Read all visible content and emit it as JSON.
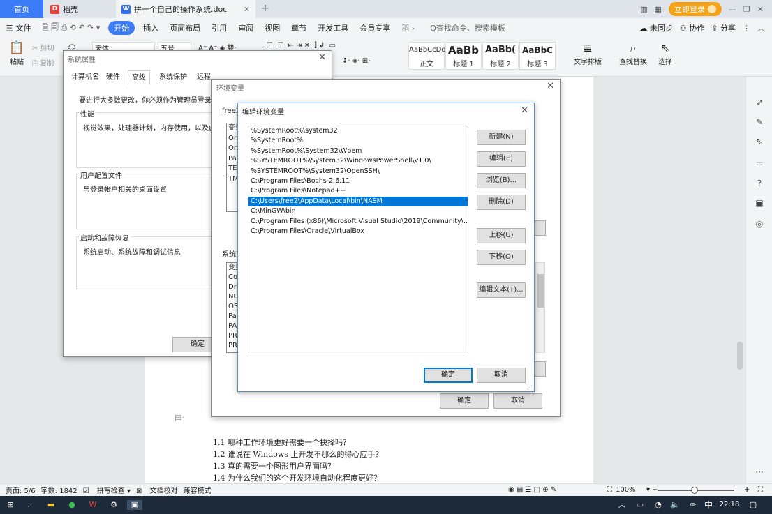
{
  "tabs": {
    "home": "首页",
    "daoke": "稻壳",
    "doc": "拼一个自己的操作系统.doc",
    "login": "立即登录"
  },
  "menu": {
    "file": "三 文件",
    "start": "开始",
    "insert": "插入",
    "layout": "页面布局",
    "ref": "引用",
    "review": "审阅",
    "view": "视图",
    "chapter": "章节",
    "dev": "开发工具",
    "member": "会员专享",
    "search": "Q查找命令、搜索模板",
    "sync": "未同步",
    "collab": "协作",
    "share": "分享"
  },
  "ribbon": {
    "paste": "粘贴",
    "cut": "剪切",
    "copy": "复制",
    "font": "宋体",
    "size": "五号",
    "styles": [
      {
        "preview": "AaBbCcDd",
        "name": "正文"
      },
      {
        "preview": "AaBb",
        "name": "标题 1"
      },
      {
        "preview": "AaBb(",
        "name": "标题 2"
      },
      {
        "preview": "AaBbC",
        "name": "标题 3"
      }
    ],
    "text_layout": "文字排版",
    "find_replace": "查找替换",
    "select": "选择"
  },
  "sysprops": {
    "title": "系统属性",
    "tabs": [
      "计算机名",
      "硬件",
      "高级",
      "系统保护",
      "远程"
    ],
    "notice": "要进行大多数更改，你必须作为管理员登录。",
    "perf_label": "性能",
    "perf_text": "视觉效果，处理器计划，内存使用，以及虚",
    "profile_label": "用户配置文件",
    "profile_text": "与登录帐户相关的桌面设置",
    "startup_label": "启动和故障恢复",
    "startup_text": "系统启动、系统故障和调试信息",
    "ok": "确定"
  },
  "envvars": {
    "title": "环境变量",
    "user_label": "free2",
    "user_vars": [
      "变量",
      "On",
      "On",
      "Pat",
      "TEI",
      "TM"
    ],
    "sys_label": "系统变",
    "sys_vars": [
      "变量",
      "Co",
      "Dri",
      "NU",
      "OS",
      "Pat",
      "PA",
      "PR",
      "PR"
    ],
    "ok": "确定",
    "cancel": "取消"
  },
  "editenv": {
    "title": "编辑环境变量",
    "paths": [
      "%SystemRoot%\\system32",
      "%SystemRoot%",
      "%SystemRoot%\\System32\\Wbem",
      "%SYSTEMROOT%\\System32\\WindowsPowerShell\\v1.0\\",
      "%SYSTEMROOT%\\System32\\OpenSSH\\",
      "C:\\Program Files\\Bochs-2.6.11",
      "C:\\Program Files\\Notepad++",
      "C:\\Users\\free2\\AppData\\Local\\bin\\NASM",
      "C:\\MinGW\\bin",
      "C:\\Program Files (x86)\\Microsoft Visual Studio\\2019\\Community\\...",
      "C:\\Program Files\\Oracle\\VirtualBox"
    ],
    "selected_index": 7,
    "btn_new": "新建(N)",
    "btn_edit": "编辑(E)",
    "btn_browse": "浏览(B)...",
    "btn_delete": "删除(D)",
    "btn_up": "上移(U)",
    "btn_down": "下移(O)",
    "btn_edit_text": "编辑文本(T)...",
    "ok": "确定",
    "cancel": "取消"
  },
  "doc_lines": [
    "1.1  哪种工作环境更好需要一个抉择吗？",
    "1.2  谁说在 Windows 上开发不那么的得心应手？",
    "1.3  真的需要一个图形用户界面吗？",
    "1.4  为什么我们的这个开发环境自动化程度更好？"
  ],
  "status": {
    "page": "页面: 5/6",
    "words": "字数: 1842",
    "spell": "拼写检查",
    "proof": "文档校对",
    "compat": "兼容模式",
    "zoom": "100%"
  },
  "taskbar": {
    "ime": "中",
    "time": "22:18"
  }
}
